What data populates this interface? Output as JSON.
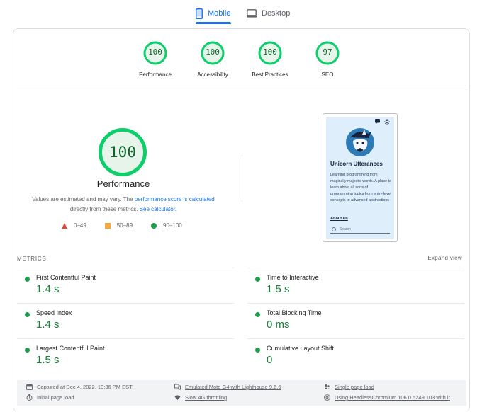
{
  "tabs": [
    {
      "label": "Mobile",
      "icon": "smartphone-icon",
      "active": true
    },
    {
      "label": "Desktop",
      "icon": "desktop-icon",
      "active": false
    }
  ],
  "categories": [
    {
      "label": "Performance",
      "score": "100"
    },
    {
      "label": "Accessibility",
      "score": "100"
    },
    {
      "label": "Best Practices",
      "score": "100"
    },
    {
      "label": "SEO",
      "score": "97"
    }
  ],
  "performance": {
    "score": "100",
    "title": "Performance",
    "desc_prefix": "Values are estimated and may vary. The ",
    "desc_link1": "performance score is calculated",
    "desc_middle": " directly from these metrics. ",
    "desc_link2": "See calculator."
  },
  "legend": [
    {
      "range": "0–49",
      "color": "#e8453c"
    },
    {
      "range": "50–89",
      "color": "#f4a93b"
    },
    {
      "range": "90–100",
      "color": "#1e9e4d"
    }
  ],
  "screenshot": {
    "site_title": "Unicorn Utterances",
    "site_desc": "Learning programming from magically majestic words. A place to learn about all sorts of programming topics from entry-level concepts to advanced abstractions",
    "link": "About Us",
    "search_placeholder": "Search"
  },
  "metrics": {
    "label": "METRICS",
    "expand": "Expand view",
    "items": [
      {
        "name": "First Contentful Paint",
        "value": "1.4 s"
      },
      {
        "name": "Time to Interactive",
        "value": "1.5 s"
      },
      {
        "name": "Speed Index",
        "value": "1.4 s"
      },
      {
        "name": "Total Blocking Time",
        "value": "0 ms"
      },
      {
        "name": "Largest Contentful Paint",
        "value": "1.5 s"
      },
      {
        "name": "Cumulative Layout Shift",
        "value": "0"
      }
    ]
  },
  "footer": {
    "captured": "Captured at Dec 4, 2022, 10:36 PM EST",
    "initial_load": "Initial page load",
    "emulated": "Emulated Moto G4 with Lighthouse 9.6.6",
    "throttling": "Slow 4G throttling",
    "single_page": "Single page load",
    "browser": "Using HeadlessChromium 106.0.5249.103 with lr"
  },
  "colors": {
    "pass": "#0cce6b",
    "pass_text": "#0d652d",
    "accent": "#1a73e8"
  }
}
